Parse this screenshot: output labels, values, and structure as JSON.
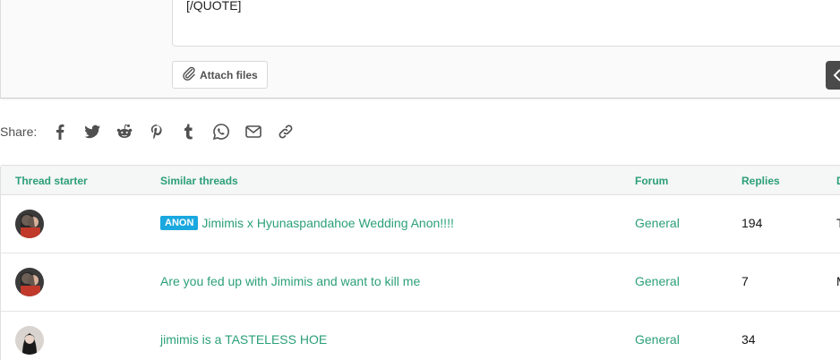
{
  "editor": {
    "content_tail": "[/QUOTE]",
    "attach_label": "Attach files"
  },
  "share": {
    "label": "Share:",
    "icons": [
      "facebook-icon",
      "twitter-icon",
      "reddit-icon",
      "pinterest-icon",
      "tumblr-icon",
      "whatsapp-icon",
      "email-icon",
      "link-icon"
    ]
  },
  "table": {
    "headers": {
      "starter": "Thread starter",
      "title": "Similar threads",
      "forum": "Forum",
      "replies": "Replies",
      "date": "D"
    },
    "rows": [
      {
        "badge": "ANON",
        "title": "Jimimis x Hyunaspandahoe Wedding Anon!!!!",
        "forum": "General",
        "replies": "194",
        "date": "T"
      },
      {
        "badge": "",
        "title": "Are you fed up with Jimimis and want to kill me",
        "forum": "General",
        "replies": "7",
        "date": "M"
      },
      {
        "badge": "",
        "title": "jimimis is a TASTELESS HOE",
        "forum": "General",
        "replies": "34",
        "date": ""
      }
    ]
  },
  "colors": {
    "accent": "#2b9f79",
    "badge": "#1aa8df",
    "header_bg": "#f5f6f6"
  }
}
